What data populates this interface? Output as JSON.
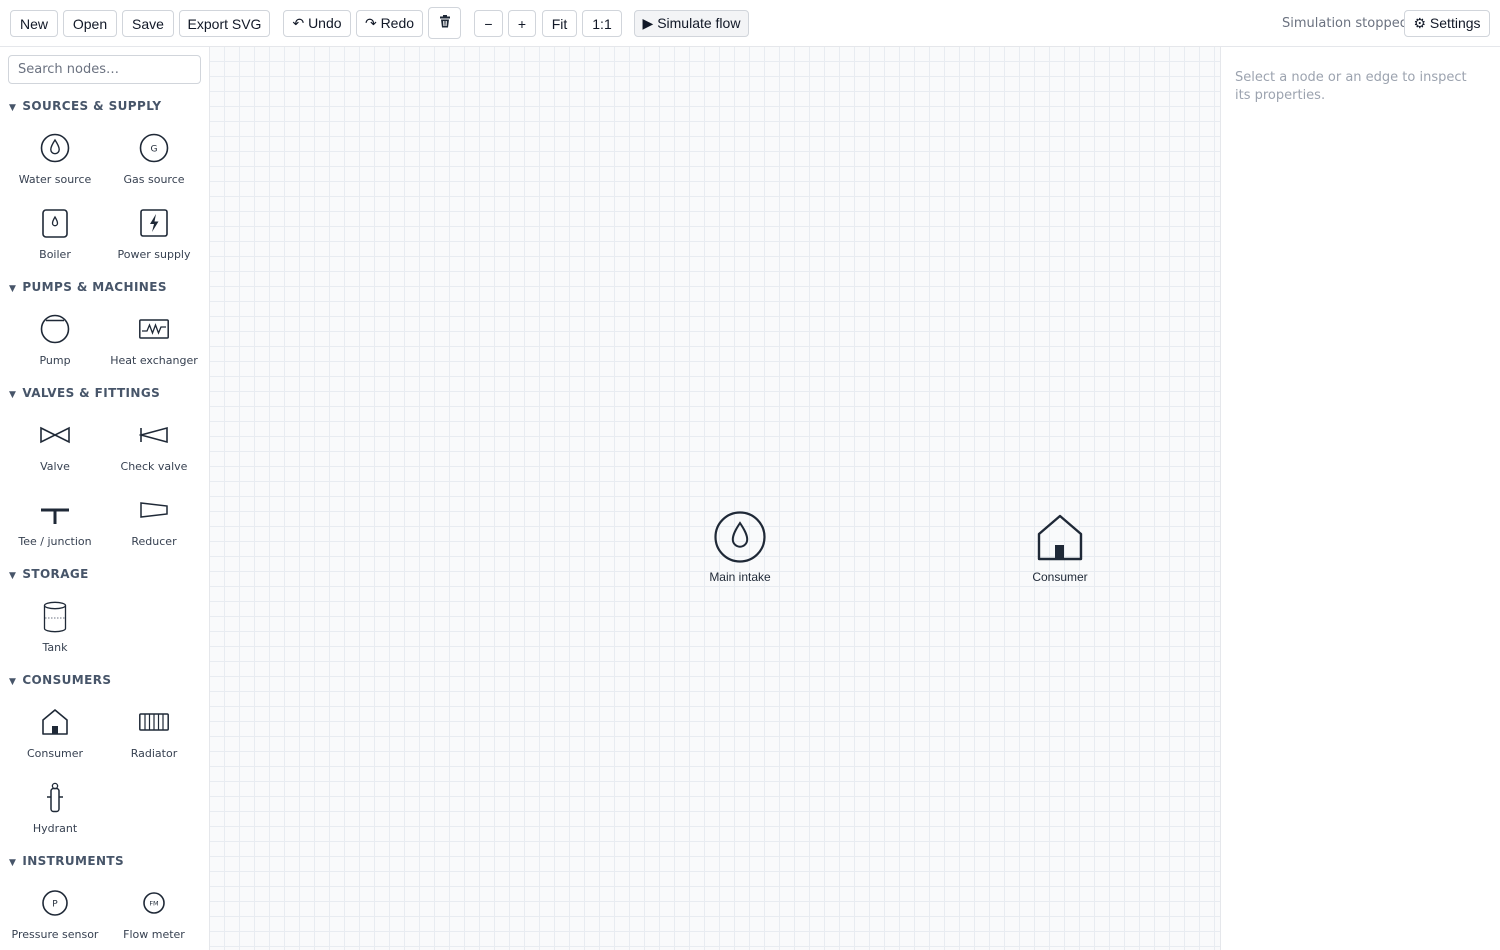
{
  "toolbar": {
    "new": "New",
    "open": "Open",
    "save": "Save",
    "export_svg": "Export SVG",
    "undo": "↶ Undo",
    "redo": "↷ Redo",
    "zoom_out": "−",
    "zoom_in": "+",
    "fit": "Fit",
    "one_to_one": "1:1",
    "simulate": "▶ Simulate flow",
    "status": "Simulation stopped",
    "settings": "⚙ Settings"
  },
  "sidebar": {
    "search_placeholder": "Search nodes…",
    "categories": [
      {
        "title": "SOURCES & SUPPLY",
        "items": [
          "Water source",
          "Gas source",
          "Boiler",
          "Power supply"
        ]
      },
      {
        "title": "PUMPS & MACHINES",
        "items": [
          "Pump",
          "Heat exchanger"
        ]
      },
      {
        "title": "VALVES & FITTINGS",
        "items": [
          "Valve",
          "Check valve",
          "Tee / junction",
          "Reducer"
        ]
      },
      {
        "title": "STORAGE",
        "items": [
          "Tank"
        ]
      },
      {
        "title": "CONSUMERS",
        "items": [
          "Consumer",
          "Radiator",
          "Hydrant"
        ]
      },
      {
        "title": "INSTRUMENTS",
        "items": [
          "Pressure sensor",
          "Flow meter"
        ]
      }
    ],
    "icon_glyphs": {
      "gas": "G",
      "pressure": "P",
      "flow": "FM"
    }
  },
  "canvas": {
    "nodes": [
      {
        "label": "Main intake",
        "icon": "water-drop-icon"
      },
      {
        "label": "Consumer",
        "icon": "house-icon"
      }
    ]
  },
  "inspector": {
    "empty_text": "Select a node or an edge to inspect its properties."
  },
  "colors": {
    "icon_stroke": "#1f2937",
    "grid": "#e8ecf1",
    "canvas_bg": "#f9fafb",
    "muted_text": "#9ca3af"
  }
}
